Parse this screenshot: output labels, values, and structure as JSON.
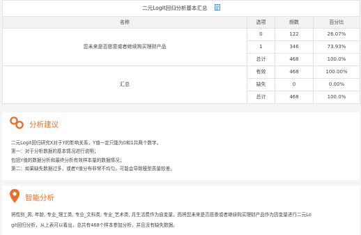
{
  "summary_table": {
    "title": "二元Logit回归分析基本汇总",
    "headers": [
      "名称",
      "选项",
      "频数",
      "百分比"
    ],
    "groups": [
      {
        "name": "您未来是否愿意或者继续购买理财产品",
        "rows": [
          {
            "option": "0",
            "count": "122",
            "percent": "26.07%"
          },
          {
            "option": "1",
            "count": "346",
            "percent": "73.93%"
          },
          {
            "option": "总计",
            "count": "468",
            "percent": "100.0%"
          }
        ]
      },
      {
        "name": "汇总",
        "rows": [
          {
            "option": "有效",
            "count": "468",
            "percent": "100.00%"
          },
          {
            "option": "缺失",
            "count": "0",
            "percent": "0.00%"
          },
          {
            "option": "总计",
            "count": "468",
            "percent": "100.0%"
          }
        ]
      }
    ]
  },
  "analysis_advice": {
    "title": "分析建议",
    "lines": [
      "二元Logit回归研究X对于Y的影响关系，Y值一定只能为0和1共两个数字。",
      "第一：对于分析数据的基本情况进行说明；",
      "包括Y值的数据分析和最终分析有效样本量的数据情况；",
      "第二：如果缺失数据过多，或者Y值分布非常不均匀，可能会导致模型质量较差。"
    ]
  },
  "smart_analysis": {
    "title": "智能分析",
    "lines": [
      "将性别_男, 年龄, 专业_理工类, 专业_文科类, 专业_艺术类, 月生活费作为自变量，而将您未来是否愿意或者继续购买理财产品作为因变量进行二元Lo",
      "git回归分析，从上表可以看出，总共有468个样本参加分析，并且没有缺失数据。"
    ]
  },
  "colors": {
    "accent": "#e8702a",
    "copy_icon": "#4a90d9",
    "header_bg": "#f2f2f2",
    "border": "#e2e2e2"
  }
}
